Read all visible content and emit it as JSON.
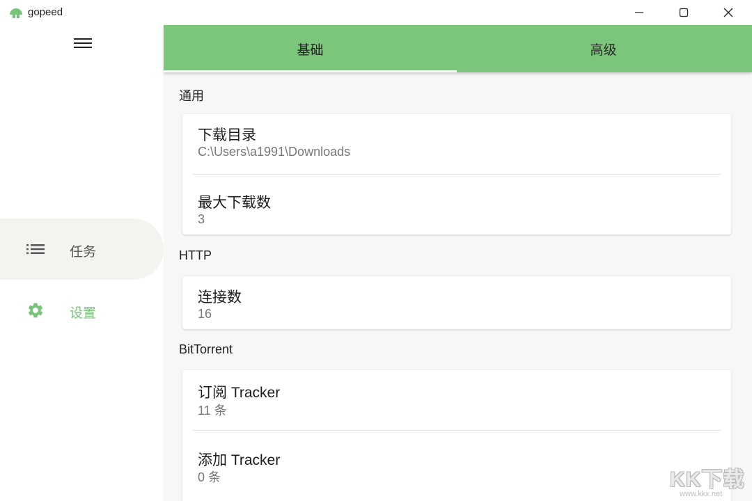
{
  "window": {
    "title": "gopeed",
    "accent": "#7bc67a"
  },
  "sidebar": {
    "menu_icon": "hamburger-menu-icon",
    "items": [
      {
        "label": "任务",
        "icon": "list-icon",
        "active": false
      },
      {
        "label": "设置",
        "icon": "gear-icon",
        "active": true
      }
    ]
  },
  "tabs": [
    {
      "label": "基础",
      "active": true
    },
    {
      "label": "高级",
      "active": false
    }
  ],
  "sections": {
    "general": {
      "title": "通用",
      "items": [
        {
          "title": "下载目录",
          "value": "C:\\Users\\a1991\\Downloads"
        },
        {
          "title": "最大下载数",
          "value": "3"
        }
      ]
    },
    "http": {
      "title": "HTTP",
      "items": [
        {
          "title": "连接数",
          "value": "16"
        }
      ]
    },
    "bittorrent": {
      "title": "BitTorrent",
      "items": [
        {
          "title": "订阅 Tracker",
          "value": "11 条"
        },
        {
          "title": "添加 Tracker",
          "value": "0 条"
        }
      ]
    }
  },
  "watermark": {
    "text": "KK下载",
    "url": "www.kkx.net"
  }
}
